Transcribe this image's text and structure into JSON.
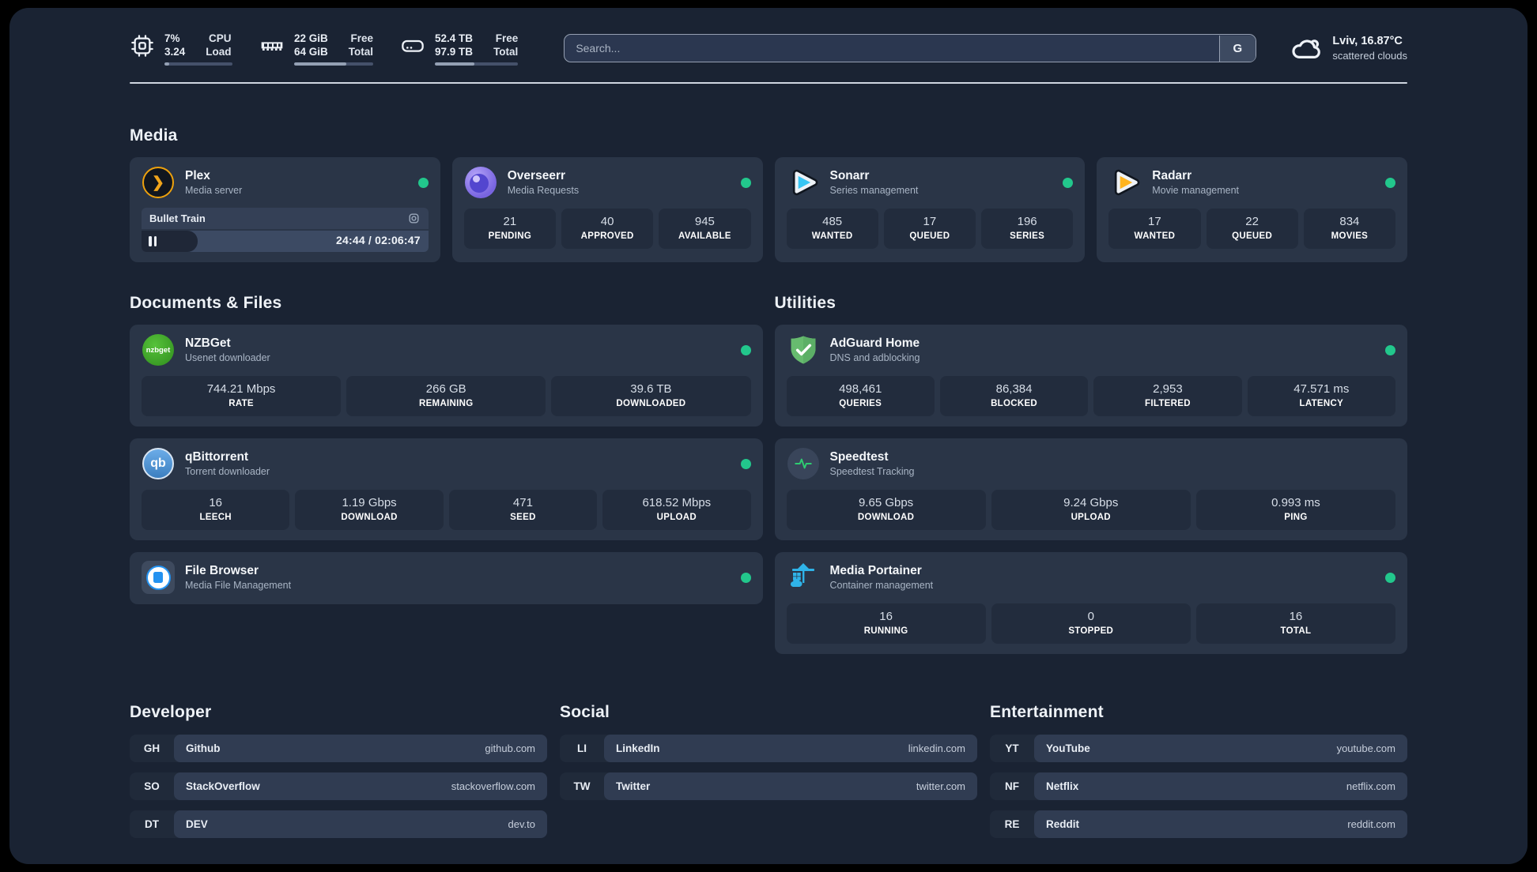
{
  "header": {
    "system_stats": [
      {
        "icon": "cpu-icon",
        "value1": "7%",
        "value2": "3.24",
        "label1": "CPU",
        "label2": "Load",
        "progress_pct": 7
      },
      {
        "icon": "ram-icon",
        "value1": "22 GiB",
        "value2": "64 GiB",
        "label1": "Free",
        "label2": "Total",
        "progress_pct": 66
      },
      {
        "icon": "disk-icon",
        "value1": "52.4 TB",
        "value2": "97.9 TB",
        "label1": "Free",
        "label2": "Total",
        "progress_pct": 47
      }
    ],
    "search_placeholder": "Search...",
    "search_button_label": "G",
    "weather": {
      "location": "Lviv, 16.87°C",
      "condition": "scattered clouds"
    }
  },
  "sections": {
    "media": {
      "title": "Media",
      "apps": [
        {
          "name": "Plex",
          "description": "Media server",
          "status": "online",
          "now_playing": {
            "title": "Bullet Train",
            "state": "paused",
            "time_display": "24:44 / 02:06:47",
            "progress_pct": 19.5
          }
        },
        {
          "name": "Overseerr",
          "description": "Media Requests",
          "status": "online",
          "stats": [
            {
              "value": "21",
              "label": "PENDING"
            },
            {
              "value": "40",
              "label": "APPROVED"
            },
            {
              "value": "945",
              "label": "AVAILABLE"
            }
          ]
        },
        {
          "name": "Sonarr",
          "description": "Series management",
          "status": "online",
          "stats": [
            {
              "value": "485",
              "label": "WANTED"
            },
            {
              "value": "17",
              "label": "QUEUED"
            },
            {
              "value": "196",
              "label": "SERIES"
            }
          ]
        },
        {
          "name": "Radarr",
          "description": "Movie management",
          "status": "online",
          "stats": [
            {
              "value": "17",
              "label": "WANTED"
            },
            {
              "value": "22",
              "label": "QUEUED"
            },
            {
              "value": "834",
              "label": "MOVIES"
            }
          ]
        }
      ]
    },
    "documents": {
      "title": "Documents & Files",
      "apps": [
        {
          "name": "NZBGet",
          "description": "Usenet downloader",
          "status": "online",
          "icon_text": "nzbget",
          "stats": [
            {
              "value": "744.21 Mbps",
              "label": "RATE"
            },
            {
              "value": "266 GB",
              "label": "REMAINING"
            },
            {
              "value": "39.6 TB",
              "label": "DOWNLOADED"
            }
          ]
        },
        {
          "name": "qBittorrent",
          "description": "Torrent downloader",
          "status": "online",
          "icon_text": "qb",
          "stats": [
            {
              "value": "16",
              "label": "LEECH"
            },
            {
              "value": "1.19 Gbps",
              "label": "DOWNLOAD"
            },
            {
              "value": "471",
              "label": "SEED"
            },
            {
              "value": "618.52 Mbps",
              "label": "UPLOAD"
            }
          ]
        },
        {
          "name": "File Browser",
          "description": "Media File Management",
          "status": "online"
        }
      ]
    },
    "utilities": {
      "title": "Utilities",
      "apps": [
        {
          "name": "AdGuard Home",
          "description": "DNS and adblocking",
          "status": "online",
          "stats": [
            {
              "value": "498,461",
              "label": "QUERIES"
            },
            {
              "value": "86,384",
              "label": "BLOCKED"
            },
            {
              "value": "2,953",
              "label": "FILTERED"
            },
            {
              "value": "47.571 ms",
              "label": "LATENCY"
            }
          ]
        },
        {
          "name": "Speedtest",
          "description": "Speedtest Tracking",
          "stats": [
            {
              "value": "9.65 Gbps",
              "label": "DOWNLOAD"
            },
            {
              "value": "9.24 Gbps",
              "label": "UPLOAD"
            },
            {
              "value": "0.993 ms",
              "label": "PING"
            }
          ]
        },
        {
          "name": "Media Portainer",
          "description": "Container management",
          "status": "online",
          "stats": [
            {
              "value": "16",
              "label": "RUNNING"
            },
            {
              "value": "0",
              "label": "STOPPED"
            },
            {
              "value": "16",
              "label": "TOTAL"
            }
          ]
        }
      ]
    },
    "developer": {
      "title": "Developer",
      "links": [
        {
          "abbr": "GH",
          "name": "Github",
          "url": "github.com"
        },
        {
          "abbr": "SO",
          "name": "StackOverflow",
          "url": "stackoverflow.com"
        },
        {
          "abbr": "DT",
          "name": "DEV",
          "url": "dev.to"
        }
      ]
    },
    "social": {
      "title": "Social",
      "links": [
        {
          "abbr": "LI",
          "name": "LinkedIn",
          "url": "linkedin.com"
        },
        {
          "abbr": "TW",
          "name": "Twitter",
          "url": "twitter.com"
        }
      ]
    },
    "entertainment": {
      "title": "Entertainment",
      "links": [
        {
          "abbr": "YT",
          "name": "YouTube",
          "url": "youtube.com"
        },
        {
          "abbr": "NF",
          "name": "Netflix",
          "url": "netflix.com"
        },
        {
          "abbr": "RE",
          "name": "Reddit",
          "url": "reddit.com"
        }
      ]
    }
  },
  "colors": {
    "status_online": "#22c78c",
    "app_background": "#1a2333",
    "card_background": "#2a3547",
    "plex_accent": "#eda10d",
    "sonarr_accent": "#38c6f4",
    "radarr_accent": "#ffb41f",
    "portainer_accent": "#2fb3e8"
  }
}
